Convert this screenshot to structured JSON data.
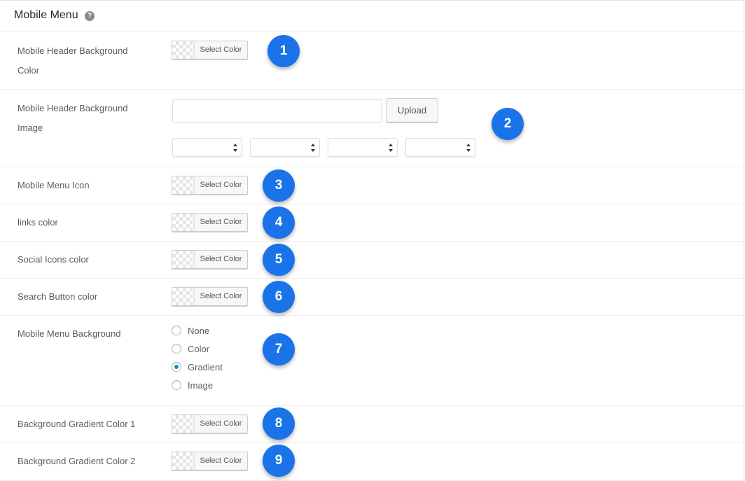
{
  "panel": {
    "title": "Mobile Menu",
    "help_icon": "question-mark-icon",
    "help_glyph": "?"
  },
  "color_button_label": "Select Color",
  "rows": {
    "header_bg_color": {
      "label_line1": "Mobile Header Background",
      "label_line2": "Color",
      "badge": "1"
    },
    "header_bg_image": {
      "label_line1": "Mobile Header Background",
      "label_line2": "Image",
      "badge": "2",
      "input_value": "",
      "upload_label": "Upload",
      "selects": [
        "",
        "",
        "",
        ""
      ]
    },
    "menu_icon": {
      "label": "Mobile Menu Icon",
      "badge": "3"
    },
    "links_color": {
      "label": "links color",
      "badge": "4"
    },
    "social_icons_color": {
      "label": "Social Icons color",
      "badge": "5"
    },
    "search_button_color": {
      "label": "Search Button color",
      "badge": "6"
    },
    "menu_background": {
      "label": "Mobile Menu Background",
      "badge": "7",
      "options": [
        {
          "label": "None",
          "checked": false
        },
        {
          "label": "Color",
          "checked": false
        },
        {
          "label": "Gradient",
          "checked": true
        },
        {
          "label": "Image",
          "checked": false
        }
      ]
    },
    "gradient_color_1": {
      "label": "Background Gradient Color 1",
      "badge": "8"
    },
    "gradient_color_2": {
      "label": "Background Gradient Color 2",
      "badge": "9"
    }
  },
  "colors": {
    "badge": "#1a73e8",
    "radio_checked": "#1e8cbe"
  }
}
